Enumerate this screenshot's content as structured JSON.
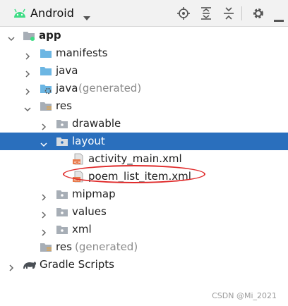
{
  "toolbar": {
    "view_label": "Android",
    "icons": [
      "android-icon",
      "chevron-down-icon",
      "locate-icon",
      "expand-all-icon",
      "collapse-all-icon",
      "gear-icon",
      "hide-icon"
    ]
  },
  "tree": {
    "app": "app",
    "manifests": "manifests",
    "java": "java",
    "java_gen_name": "java",
    "java_gen_suffix": "(generated)",
    "res": "res",
    "drawable": "drawable",
    "layout": "layout",
    "activity_main": "activity_main.xml",
    "poem_list_item": "poem_list_item.xml",
    "mipmap": "mipmap",
    "values": "values",
    "xml": "xml",
    "res_gen_name": "res",
    "res_gen_suffix": "(generated)",
    "gradle_scripts": "Gradle Scripts"
  },
  "colors": {
    "selection": "#2a6fbd",
    "folder_blue": "#6cb6e3",
    "folder_gray": "#a7aeb6",
    "xml_orange": "#e8794a",
    "highlight_oval": "#e02b2b"
  },
  "watermark": "CSDN @Mi_2021"
}
